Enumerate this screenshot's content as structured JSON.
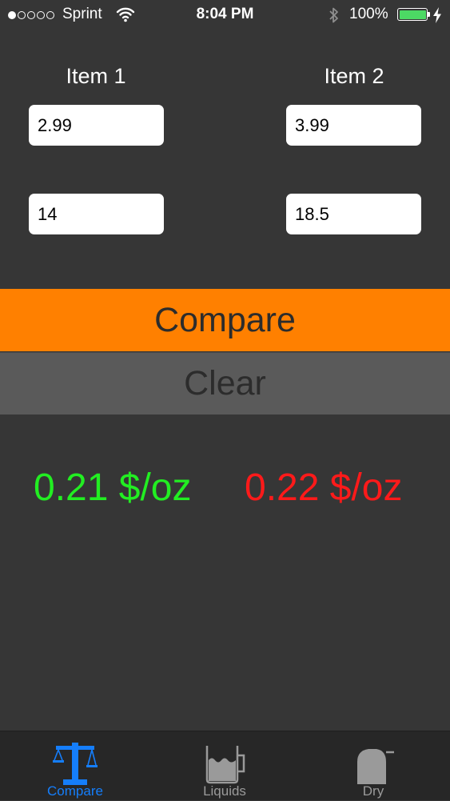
{
  "status_bar": {
    "signal_dots_filled": 1,
    "signal_dots_total": 5,
    "carrier": "Sprint",
    "time": "8:04 PM",
    "battery": "100%",
    "battery_level": 1.0
  },
  "items": {
    "item1_label": "Item 1",
    "item2_label": "Item 2",
    "item1_price": "2.99",
    "item2_price": "3.99",
    "item1_size": "14",
    "item2_size": "18.5"
  },
  "buttons": {
    "compare": "Compare",
    "clear": "Clear"
  },
  "results": {
    "item1": "0.21 $/oz",
    "item2": "0.22 $/oz",
    "item1_color": "#22ee22",
    "item2_color": "#ff1a1a"
  },
  "tab_bar": {
    "tabs": [
      {
        "label": "Compare",
        "icon": "balance-scale-icon",
        "active": true
      },
      {
        "label": "Liquids",
        "icon": "liquid-container-icon",
        "active": false
      },
      {
        "label": "Dry",
        "icon": "dry-container-icon",
        "active": false
      }
    ],
    "active_color": "#157efb",
    "inactive_color": "#9a9a9a"
  },
  "colors": {
    "background": "#363636",
    "compare_button": "#ff8000",
    "clear_button": "#5a5a5a"
  }
}
